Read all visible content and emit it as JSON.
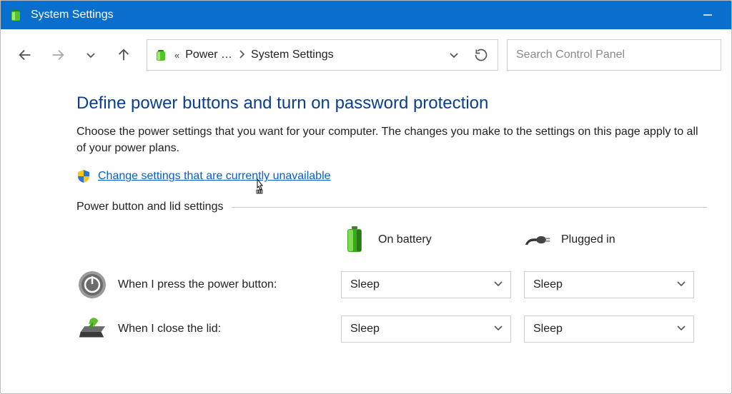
{
  "titlebar": {
    "title": "System Settings"
  },
  "toolbar": {
    "breadcrumb": {
      "parent": "Power …",
      "current": "System Settings"
    },
    "search_placeholder": "Search Control Panel"
  },
  "page": {
    "headline": "Define power buttons and turn on password protection",
    "description": "Choose the power settings that you want for your computer. The changes you make to the settings on this page apply to all of your power plans.",
    "change_link": "Change settings that are currently unavailable",
    "section_label": "Power button and lid settings",
    "columns": {
      "battery": "On battery",
      "plugged": "Plugged in"
    },
    "rows": [
      {
        "label": "When I press the power button:",
        "battery_value": "Sleep",
        "plugged_value": "Sleep"
      },
      {
        "label": "When I close the lid:",
        "battery_value": "Sleep",
        "plugged_value": "Sleep"
      }
    ]
  }
}
